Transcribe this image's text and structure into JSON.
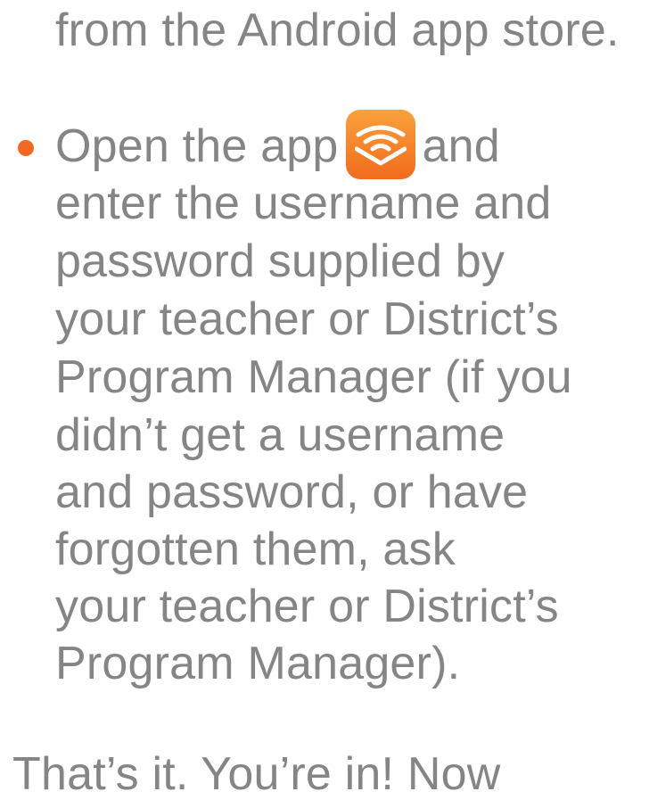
{
  "text": {
    "line_0": "from the Android app store.",
    "line_1_before": "Open the app",
    "line_1_after": "and",
    "line_2": "enter the username and",
    "line_3": "password supplied by",
    "line_4": "your teacher or District’s",
    "line_5": "Program Manager (if you",
    "line_6": "didn’t get a username",
    "line_7": "and password, or have",
    "line_8": "forgotten them, ask",
    "line_9": "your teacher or District’s",
    "line_10": "Program Manager).",
    "final_line": "That’s it. You’re in! Now"
  },
  "icons": {
    "bullet": "bullet-dot-icon",
    "app": "audible-app-icon"
  },
  "colors": {
    "text": "#858585",
    "bullet": "#f26722",
    "app_icon_top": "#f9a13b",
    "app_icon_bottom": "#f26b1d"
  }
}
